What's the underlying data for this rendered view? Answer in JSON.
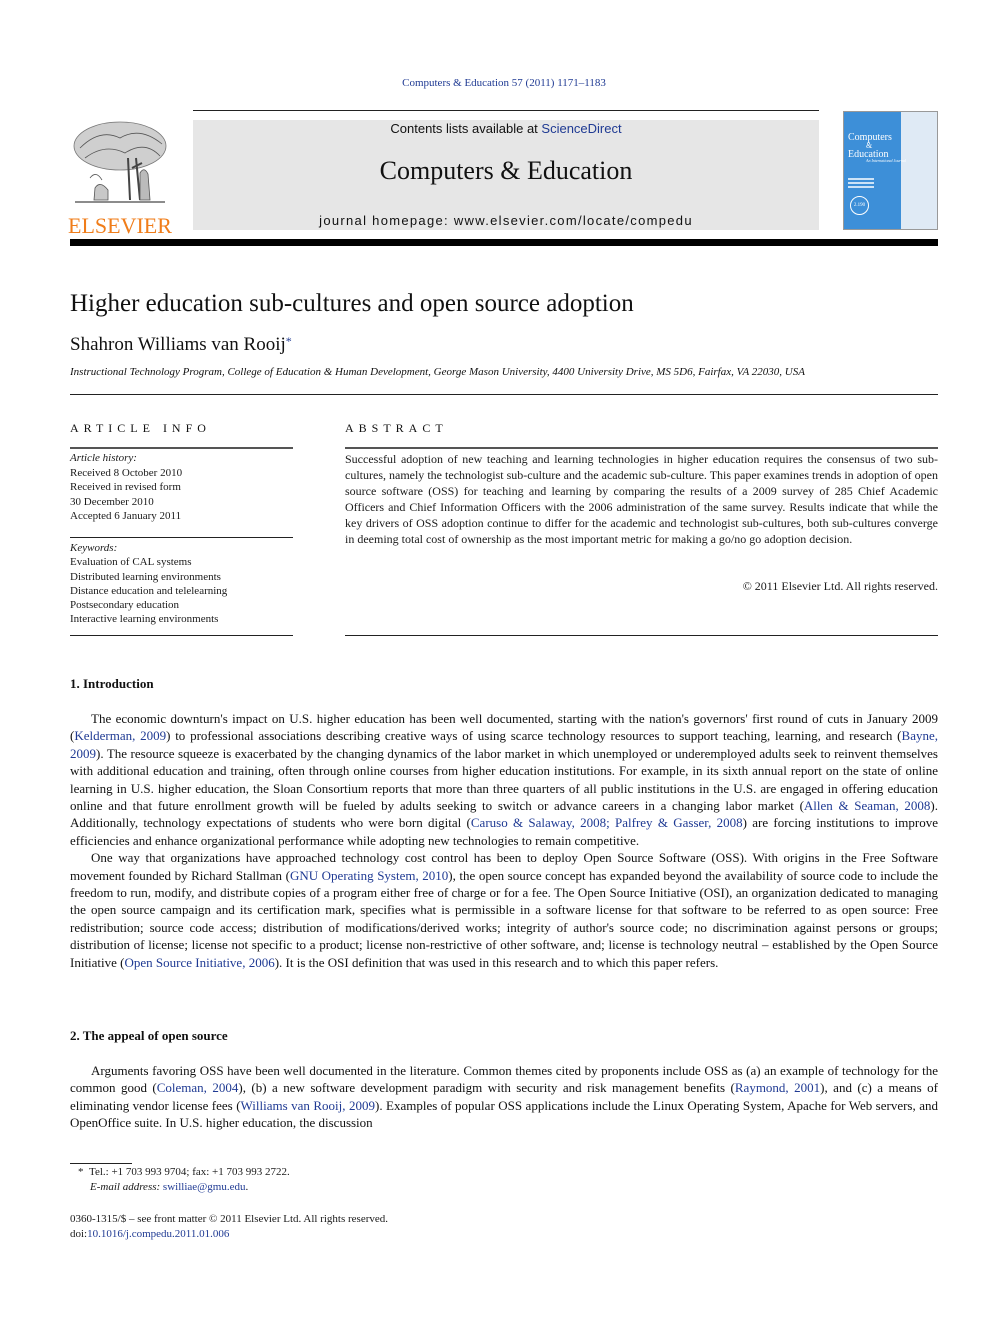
{
  "header": {
    "citation": "Computers & Education 57 (2011) 1171–1183",
    "contents_prefix": "Contents lists available at ",
    "contents_link": "ScienceDirect",
    "journal_title": "Computers & Education",
    "homepage_prefix": "journal homepage: ",
    "homepage_url": "www.elsevier.com/locate/compedu",
    "publisher_logo_text": "ELSEVIER",
    "cover": {
      "title_line1": "Computers",
      "title_line2": "&",
      "title_line3": "Education",
      "subtitle": "An International Journal",
      "badge": "2.190"
    }
  },
  "article": {
    "title": "Higher education sub-cultures and open source adoption",
    "author": "Shahron Williams van Rooij",
    "author_mark": "*",
    "affiliation": "Instructional Technology Program, College of Education & Human Development, George Mason University, 4400 University Drive, MS 5D6, Fairfax, VA 22030, USA"
  },
  "article_info": {
    "heading": "ARTICLE INFO",
    "history_label": "Article history:",
    "history": [
      "Received 8 October 2010",
      "Received in revised form",
      "30 December 2010",
      "Accepted 6 January 2011"
    ],
    "keywords_label": "Keywords:",
    "keywords": [
      "Evaluation of CAL systems",
      "Distributed learning environments",
      "Distance education and telelearning",
      "Postsecondary education",
      "Interactive learning environments"
    ]
  },
  "abstract": {
    "heading": "ABSTRACT",
    "text": "Successful adoption of new teaching and learning technologies in higher education requires the consensus of two sub-cultures, namely the technologist sub-culture and the academic sub-culture. This paper examines trends in adoption of open source software (OSS) for teaching and learning by comparing the results of a 2009 survey of 285 Chief Academic Officers and Chief Information Officers with the 2006 administration of the same survey. Results indicate that while the key drivers of OSS adoption continue to differ for the academic and technologist sub-cultures, both sub-cultures converge in deeming total cost of ownership as the most important metric for making a go/no go adoption decision.",
    "copyright": "© 2011 Elsevier Ltd. All rights reserved."
  },
  "sections": {
    "s1": {
      "heading": "1.  Introduction",
      "p1": {
        "t1": "The economic downturn's impact on U.S. higher education has been well documented, starting with the nation's governors' first round of cuts in January 2009 (",
        "c1": "Kelderman, 2009",
        "t2": ") to professional associations describing creative ways of using scarce technology resources to support teaching, learning, and research (",
        "c2": "Bayne, 2009",
        "t3": "). The resource squeeze is exacerbated by the changing dynamics of the labor market in which unemployed or underemployed adults seek to reinvent themselves with additional education and training, often through online courses from higher education institutions. For example, in its sixth annual report on the state of online learning in U.S. higher education, the Sloan Consortium reports that more than three quarters of all public institutions in the U.S. are engaged in offering education online and that future enrollment growth will be fueled by adults seeking to switch or advance careers in a changing labor market (",
        "c3": "Allen & Seaman, 2008",
        "t4": "). Additionally, technology expectations of students who were born digital (",
        "c4": "Caruso & Salaway, 2008; Palfrey & Gasser, 2008",
        "t5": ") are forcing institutions to improve efficiencies and enhance organizational performance while adopting new technologies to remain competitive."
      },
      "p2": {
        "t1": "One way that organizations have approached technology cost control has been to deploy Open Source Software (OSS). With origins in the Free Software movement founded by Richard Stallman (",
        "c1": "GNU Operating System, 2010",
        "t2": "), the open source concept has expanded beyond the availability of source code to include the freedom to run, modify, and distribute copies of a program either free of charge or for a fee. The Open Source Initiative (OSI), an organization dedicated to managing the open source campaign and its certification mark, specifies what is permissible in a software license for that software to be referred to as open source: Free redistribution; source code access; distribution of modifications/derived works; integrity of author's source code; no discrimination against persons or groups; distribution of license; license not specific to a product; license non-restrictive of other software, and; license is technology neutral – established by the Open Source Initiative (",
        "c2": "Open Source Initiative, 2006",
        "t3": "). It is the OSI definition that was used in this research and to which this paper refers."
      }
    },
    "s2": {
      "heading": "2.  The appeal of open source",
      "p1": {
        "t1": "Arguments favoring OSS have been well documented in the literature. Common themes cited by proponents include OSS as (a) an example of technology for the common good (",
        "c1": "Coleman, 2004",
        "t2": "), (b) a new software development paradigm with security and risk management benefits (",
        "c2": "Raymond, 2001",
        "t3": "), and (c) a means of eliminating vendor license fees (",
        "c3": "Williams van Rooij, 2009",
        "t4": "). Examples of popular OSS applications include the Linux Operating System, Apache for Web servers, and OpenOffice suite. In U.S. higher education, the discussion"
      }
    }
  },
  "footnote": {
    "mark": "*",
    "tel": "Tel.: +1 703 993 9704; fax: +1 703 993 2722.",
    "email_label": "E-mail address: ",
    "email": "swilliae@gmu.edu",
    "email_suffix": "."
  },
  "front_matter": {
    "issn_line": "0360-1315/$ – see front matter © 2011 Elsevier Ltd. All rights reserved.",
    "doi_label": "doi:",
    "doi": "10.1016/j.compedu.2011.01.006"
  }
}
